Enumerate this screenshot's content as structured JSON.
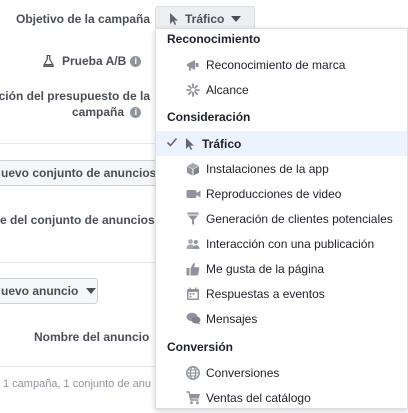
{
  "objective": {
    "label": "Objetivo de la campaña",
    "button": "Tráfico"
  },
  "ab_test": {
    "label": "Prueba A/B"
  },
  "budget": {
    "line1": "ción del presupuesto de la",
    "line2": "campaña"
  },
  "ad_set_button": "uevo conjunto de anuncios",
  "ad_set_name": "e del conjunto de anuncios",
  "ad_button": "uevo anuncio",
  "ad_name": "Nombre del anuncio",
  "footer": "1 campaña, 1 conjunto de anu",
  "dropdown": {
    "sections": [
      {
        "title": "Reconocimiento",
        "items": [
          {
            "label": "Reconocimiento de marca",
            "icon": "megaphone-icon"
          },
          {
            "label": "Alcance",
            "icon": "asterisk-icon"
          }
        ]
      },
      {
        "title": "Consideración",
        "items": [
          {
            "label": "Tráfico",
            "icon": "cursor-icon",
            "selected": true
          },
          {
            "label": "Instalaciones de la app",
            "icon": "box-icon"
          },
          {
            "label": "Reproducciones de video",
            "icon": "video-camera-icon"
          },
          {
            "label": "Generación de clientes potenciales",
            "icon": "funnel-icon"
          },
          {
            "label": "Interacción con una publicación",
            "icon": "people-icon"
          },
          {
            "label": "Me gusta de la página",
            "icon": "thumbs-up-icon"
          },
          {
            "label": "Respuestas a eventos",
            "icon": "calendar-icon"
          },
          {
            "label": "Mensajes",
            "icon": "chat-icon"
          }
        ]
      },
      {
        "title": "Conversión",
        "items": [
          {
            "label": "Conversiones",
            "icon": "globe-icon"
          },
          {
            "label": "Ventas del catálogo",
            "icon": "cart-icon"
          }
        ]
      }
    ]
  }
}
